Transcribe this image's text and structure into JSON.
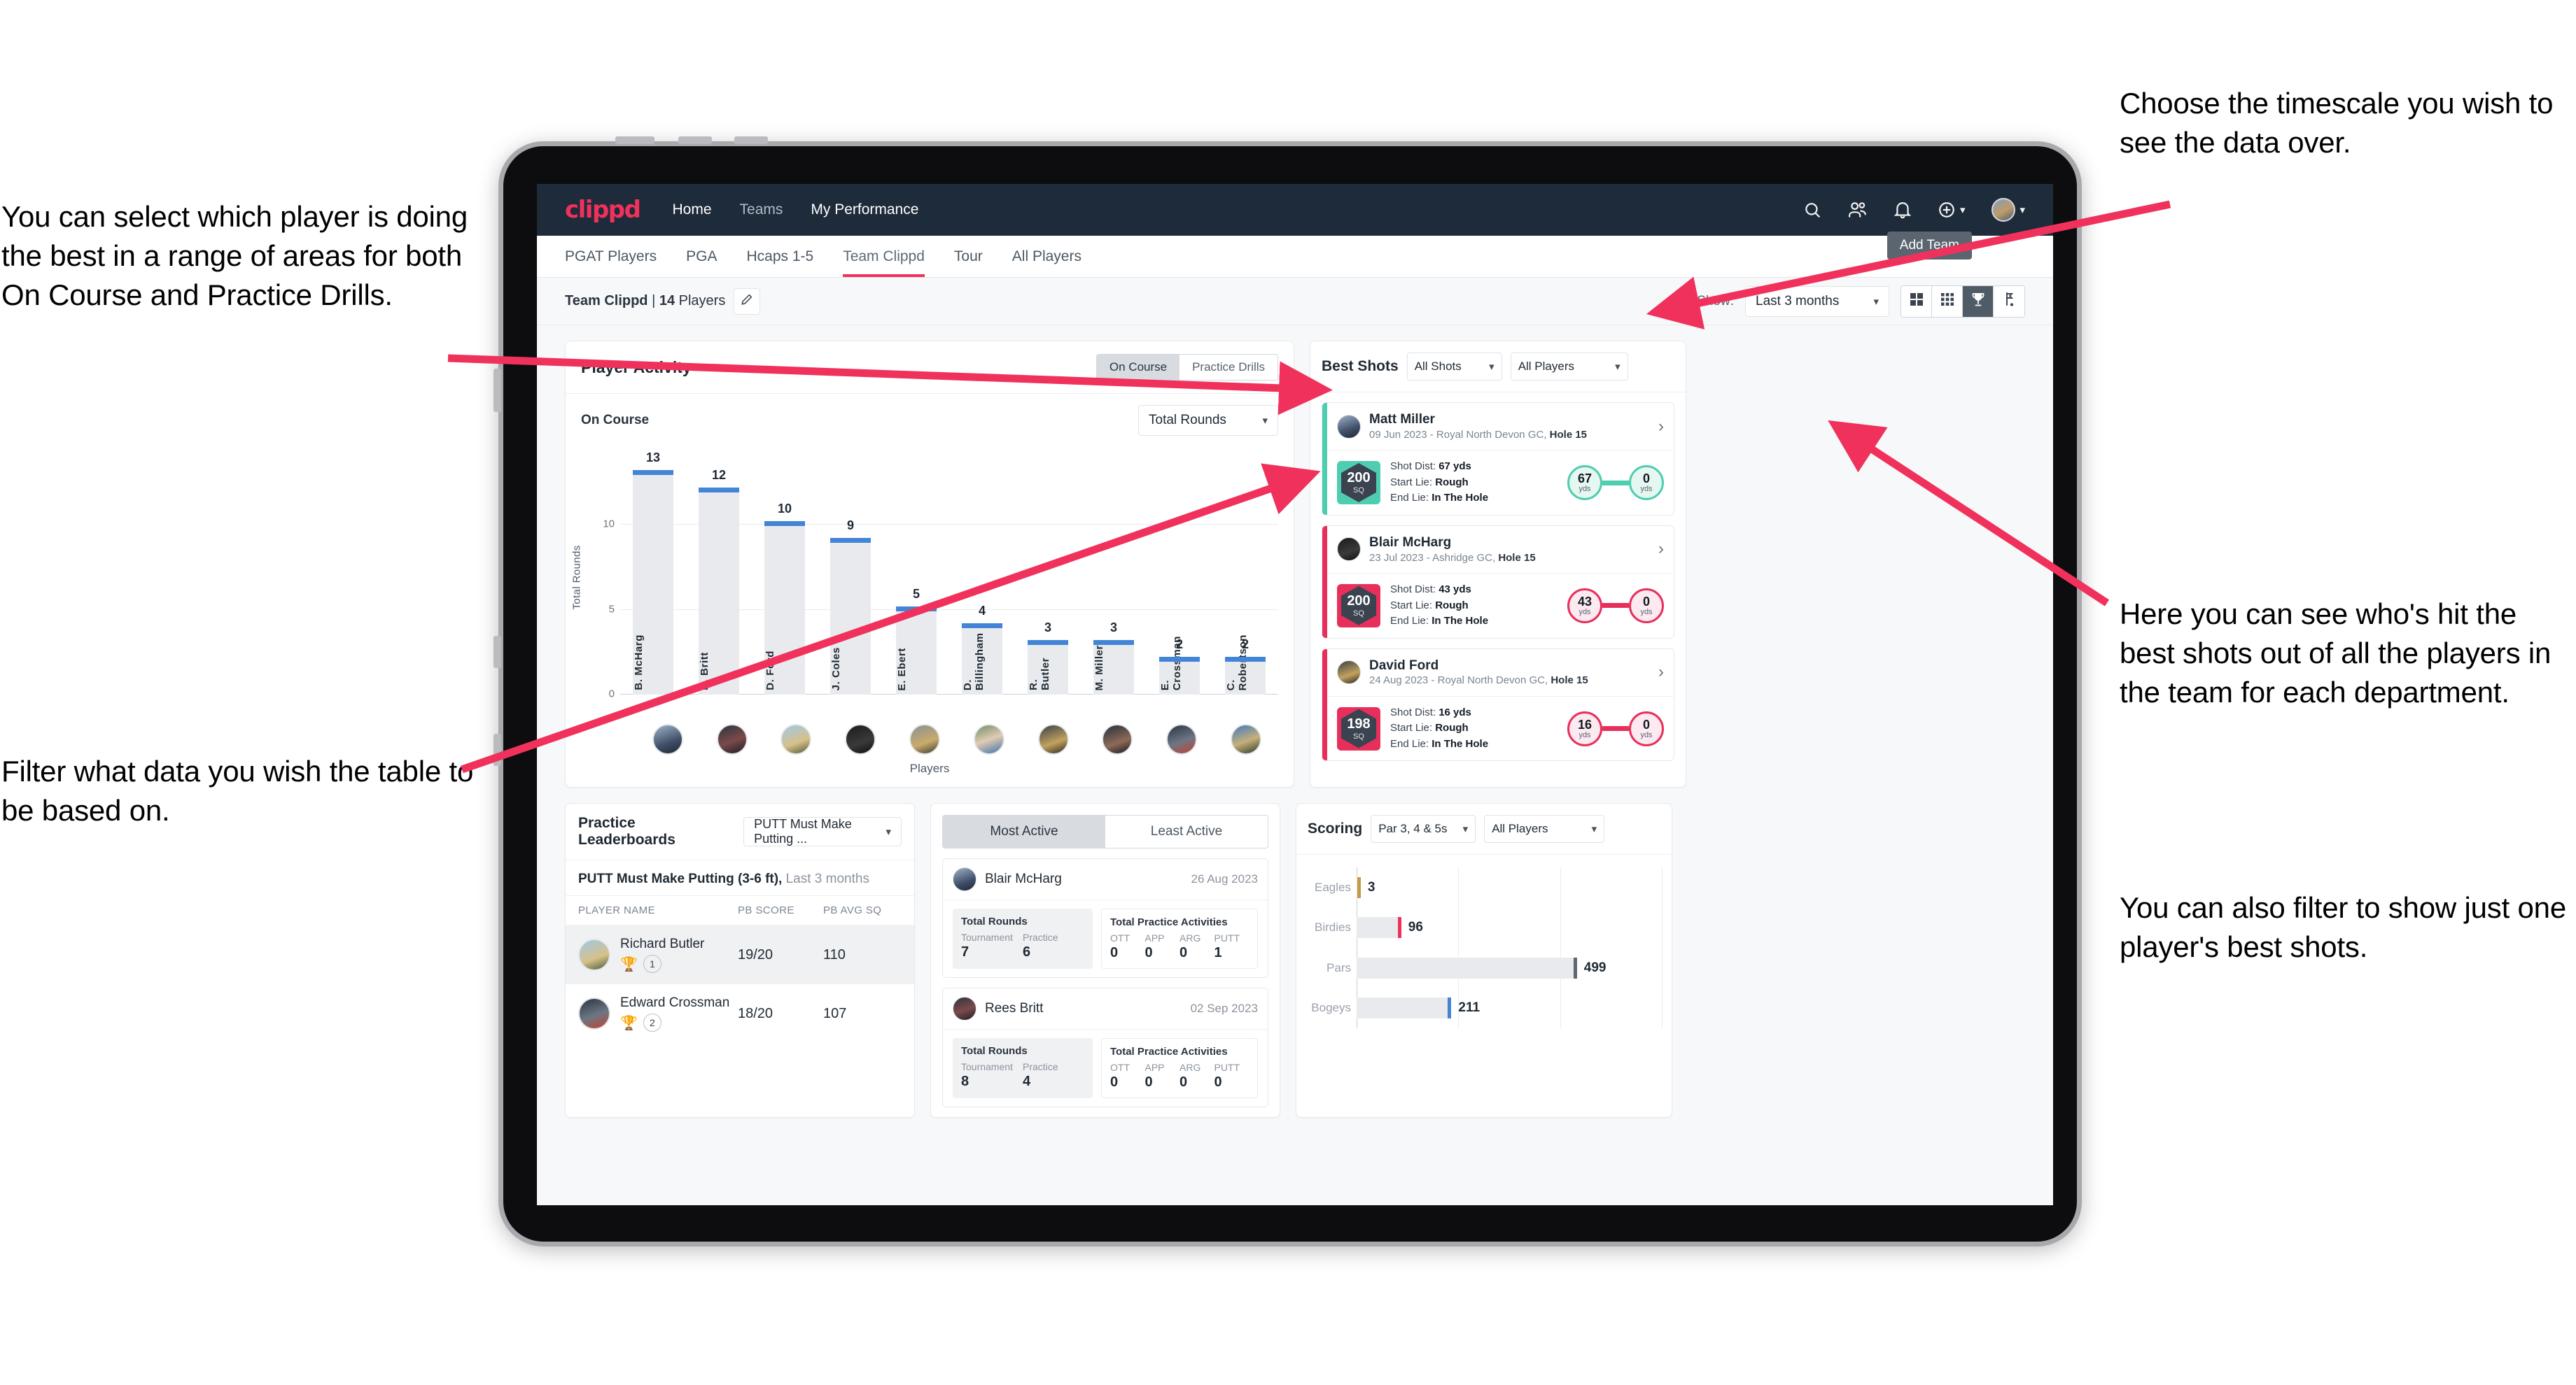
{
  "annotations": {
    "left_top": "You can select which player is doing the best in a range of areas for both On Course and Practice Drills.",
    "left_bottom": "Filter what data you wish the table to be based on.",
    "right_top": "Choose the timescale you wish to see the data over.",
    "right_middle": "Here you can see who's hit the best shots out of all the players in the team for each department.",
    "right_bottom": "You can also filter to show just one player's best shots."
  },
  "topnav": {
    "brand": "clippd",
    "links": [
      {
        "label": "Home",
        "active": true
      },
      {
        "label": "Teams",
        "active": false
      },
      {
        "label": "My Performance",
        "active": true
      }
    ],
    "icons": [
      "search-icon",
      "people-icon",
      "bell-icon",
      "plus-circle-icon",
      "avatar"
    ]
  },
  "tabs": [
    {
      "label": "PGAT Players",
      "active": false
    },
    {
      "label": "PGA",
      "active": false
    },
    {
      "label": "Hcaps 1-5",
      "active": false
    },
    {
      "label": "Team Clippd",
      "active": true
    },
    {
      "label": "Tour",
      "active": false
    },
    {
      "label": "All Players",
      "active": false
    }
  ],
  "tooltip": {
    "add_team": "Add Team"
  },
  "filterbar": {
    "team_name": "Team Clippd",
    "team_sep": " | ",
    "player_count": "14",
    "players_word": " Players",
    "edit_icon": "pencil-icon",
    "show_label": "Show:",
    "timescale_value": "Last 3 months",
    "views": [
      {
        "icon": "grid-large-icon",
        "active": false
      },
      {
        "icon": "grid-small-icon",
        "active": false
      },
      {
        "icon": "trophy-icon",
        "active": true
      },
      {
        "icon": "golf-flag-icon",
        "active": false
      }
    ]
  },
  "player_activity": {
    "title": "Player Activity",
    "segments": [
      {
        "label": "On Course",
        "active": true
      },
      {
        "label": "Practice Drills",
        "active": false
      }
    ],
    "sub_label": "On Course",
    "metric_value": "Total Rounds"
  },
  "best_shots": {
    "title": "Best Shots",
    "shot_filter": "All Shots",
    "player_filter": "All Players",
    "items": [
      {
        "name": "Matt Miller",
        "date": "09 Jun 2023",
        "course": "Royal North Devon GC,",
        "hole": "Hole 15",
        "sq": "200",
        "sq_unit": "SQ",
        "shot_dist_label": "Shot Dist:",
        "shot_dist": "67 yds",
        "start_lie_label": "Start Lie:",
        "start_lie": "Rough",
        "end_lie_label": "End Lie:",
        "end_lie": "In The Hole",
        "from_val": "67",
        "from_unit": "yds",
        "to_val": "0",
        "to_unit": "yds",
        "color": "#4ecdb0"
      },
      {
        "name": "Blair McHarg",
        "date": "23 Jul 2023",
        "course": "Ashridge GC,",
        "hole": "Hole 15",
        "sq": "200",
        "sq_unit": "SQ",
        "shot_dist_label": "Shot Dist:",
        "shot_dist": "43 yds",
        "start_lie_label": "Start Lie:",
        "start_lie": "Rough",
        "end_lie_label": "End Lie:",
        "end_lie": "In The Hole",
        "from_val": "43",
        "from_unit": "yds",
        "to_val": "0",
        "to_unit": "yds",
        "color": "#e82f5b"
      },
      {
        "name": "David Ford",
        "date": "24 Aug 2023",
        "course": "Royal North Devon GC,",
        "hole": "Hole 15",
        "sq": "198",
        "sq_unit": "SQ",
        "shot_dist_label": "Shot Dist:",
        "shot_dist": "16 yds",
        "start_lie_label": "Start Lie:",
        "start_lie": "Rough",
        "end_lie_label": "End Lie:",
        "end_lie": "In The Hole",
        "from_val": "16",
        "from_unit": "yds",
        "to_val": "0",
        "to_unit": "yds",
        "color": "#e82f5b"
      }
    ]
  },
  "practice_leaderboards": {
    "title": "Practice Leaderboards",
    "drill_filter": "PUTT Must Make Putting ...",
    "subtitle_bold": "PUTT Must Make Putting (3-6 ft),",
    "subtitle_rest": " Last 3 months",
    "columns": [
      "PLAYER NAME",
      "PB SCORE",
      "PB AVG SQ"
    ],
    "rows": [
      {
        "name": "Richard Butler",
        "trophy": "gold",
        "rank": "1",
        "pb_score": "19/20",
        "pb_avg_sq": "110"
      },
      {
        "name": "Edward Crossman",
        "trophy": "silver",
        "rank": "2",
        "pb_score": "18/20",
        "pb_avg_sq": "107"
      }
    ]
  },
  "activity": {
    "tabs": [
      {
        "label": "Most Active",
        "active": true
      },
      {
        "label": "Least Active",
        "active": false
      }
    ],
    "rounds_title": "Total Rounds",
    "practice_title": "Total Practice Activities",
    "rounds_keys": [
      "Tournament",
      "Practice"
    ],
    "practice_keys": [
      "OTT",
      "APP",
      "ARG",
      "PUTT"
    ],
    "items": [
      {
        "name": "Blair McHarg",
        "date": "26 Aug 2023",
        "rounds": [
          "7",
          "6"
        ],
        "practice": [
          "0",
          "0",
          "0",
          "1"
        ]
      },
      {
        "name": "Rees Britt",
        "date": "02 Sep 2023",
        "rounds": [
          "8",
          "4"
        ],
        "practice": [
          "0",
          "0",
          "0",
          "0"
        ]
      }
    ]
  },
  "scoring": {
    "title": "Scoring",
    "par_filter": "Par 3, 4 & 5s",
    "player_filter": "All Players"
  },
  "chart_data": [
    {
      "type": "bar",
      "title": "Player Activity - On Course",
      "xlabel": "Players",
      "ylabel": "Total Rounds",
      "ylim": [
        0,
        14
      ],
      "yticks": [
        0,
        5,
        10
      ],
      "grid": true,
      "categories": [
        "B. McHarg",
        "R. Britt",
        "D. Ford",
        "J. Coles",
        "E. Ebert",
        "D. Billingham",
        "R. Butler",
        "M. Miller",
        "E. Crossman",
        "C. Robertson"
      ],
      "values": [
        13,
        12,
        10,
        9,
        5,
        4,
        3,
        3,
        2,
        2
      ],
      "bar_color": "#e8eaed",
      "cap_color": "#4285d6"
    },
    {
      "type": "bar",
      "orientation": "horizontal",
      "title": "Scoring",
      "xlabel": "",
      "ylabel": "",
      "xlim": [
        0,
        700
      ],
      "grid": true,
      "categories": [
        "Eagles",
        "Birdies",
        "Pars",
        "Bogeys"
      ],
      "values": [
        3,
        96,
        499,
        211
      ],
      "cap_colors": [
        "#c39b49",
        "#f0315c",
        "#5f6670",
        "#4285d6"
      ],
      "bar_color": "#e8eaed"
    }
  ]
}
